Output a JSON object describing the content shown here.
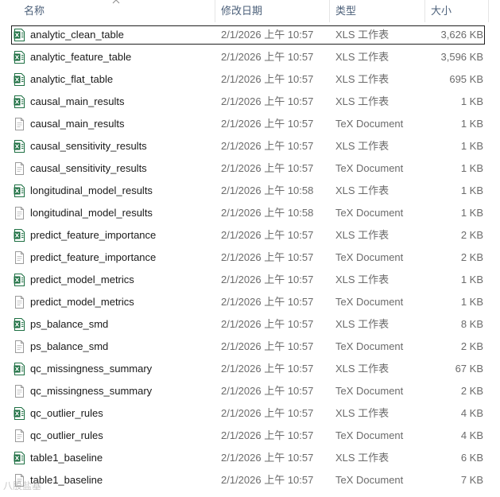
{
  "columns": {
    "name": "名称",
    "modified": "修改日期",
    "type": "类型",
    "size": "大小"
  },
  "sort_icon": "chevron-up-icon",
  "icons": {
    "xls": "excel-file-icon",
    "tex": "tex-document-icon"
  },
  "colors": {
    "header_text": "#4c607a",
    "excel_green": "#1d6f42",
    "secondary_text": "#6b6b6b"
  },
  "files": [
    {
      "name": "analytic_clean_table",
      "modified": "2/1/2026 上午 10:57",
      "type": "XLS 工作表",
      "size": "3,626 KB",
      "kind": "xls",
      "selected": true
    },
    {
      "name": "analytic_feature_table",
      "modified": "2/1/2026 上午 10:57",
      "type": "XLS 工作表",
      "size": "3,596 KB",
      "kind": "xls"
    },
    {
      "name": "analytic_flat_table",
      "modified": "2/1/2026 上午 10:57",
      "type": "XLS 工作表",
      "size": "695 KB",
      "kind": "xls"
    },
    {
      "name": "causal_main_results",
      "modified": "2/1/2026 上午 10:57",
      "type": "XLS 工作表",
      "size": "1 KB",
      "kind": "xls"
    },
    {
      "name": "causal_main_results",
      "modified": "2/1/2026 上午 10:57",
      "type": "TeX Document",
      "size": "1 KB",
      "kind": "tex"
    },
    {
      "name": "causal_sensitivity_results",
      "modified": "2/1/2026 上午 10:57",
      "type": "XLS 工作表",
      "size": "1 KB",
      "kind": "xls"
    },
    {
      "name": "causal_sensitivity_results",
      "modified": "2/1/2026 上午 10:57",
      "type": "TeX Document",
      "size": "1 KB",
      "kind": "tex"
    },
    {
      "name": "longitudinal_model_results",
      "modified": "2/1/2026 上午 10:58",
      "type": "XLS 工作表",
      "size": "1 KB",
      "kind": "xls"
    },
    {
      "name": "longitudinal_model_results",
      "modified": "2/1/2026 上午 10:58",
      "type": "TeX Document",
      "size": "1 KB",
      "kind": "tex"
    },
    {
      "name": "predict_feature_importance",
      "modified": "2/1/2026 上午 10:57",
      "type": "XLS 工作表",
      "size": "2 KB",
      "kind": "xls"
    },
    {
      "name": "predict_feature_importance",
      "modified": "2/1/2026 上午 10:57",
      "type": "TeX Document",
      "size": "2 KB",
      "kind": "tex"
    },
    {
      "name": "predict_model_metrics",
      "modified": "2/1/2026 上午 10:57",
      "type": "XLS 工作表",
      "size": "1 KB",
      "kind": "xls"
    },
    {
      "name": "predict_model_metrics",
      "modified": "2/1/2026 上午 10:57",
      "type": "TeX Document",
      "size": "1 KB",
      "kind": "tex"
    },
    {
      "name": "ps_balance_smd",
      "modified": "2/1/2026 上午 10:57",
      "type": "XLS 工作表",
      "size": "8 KB",
      "kind": "xls"
    },
    {
      "name": "ps_balance_smd",
      "modified": "2/1/2026 上午 10:57",
      "type": "TeX Document",
      "size": "2 KB",
      "kind": "tex"
    },
    {
      "name": "qc_missingness_summary",
      "modified": "2/1/2026 上午 10:57",
      "type": "XLS 工作表",
      "size": "67 KB",
      "kind": "xls"
    },
    {
      "name": "qc_missingness_summary",
      "modified": "2/1/2026 上午 10:57",
      "type": "TeX Document",
      "size": "2 KB",
      "kind": "tex"
    },
    {
      "name": "qc_outlier_rules",
      "modified": "2/1/2026 上午 10:57",
      "type": "XLS 工作表",
      "size": "4 KB",
      "kind": "xls"
    },
    {
      "name": "qc_outlier_rules",
      "modified": "2/1/2026 上午 10:57",
      "type": "TeX Document",
      "size": "4 KB",
      "kind": "tex"
    },
    {
      "name": "table1_baseline",
      "modified": "2/1/2026 上午 10:57",
      "type": "XLS 工作表",
      "size": "6 KB",
      "kind": "xls"
    },
    {
      "name": "table1_baseline",
      "modified": "2/1/2026 上午 10:57",
      "type": "TeX Document",
      "size": "7 KB",
      "kind": "tex"
    }
  ],
  "watermark": "八股盐基"
}
